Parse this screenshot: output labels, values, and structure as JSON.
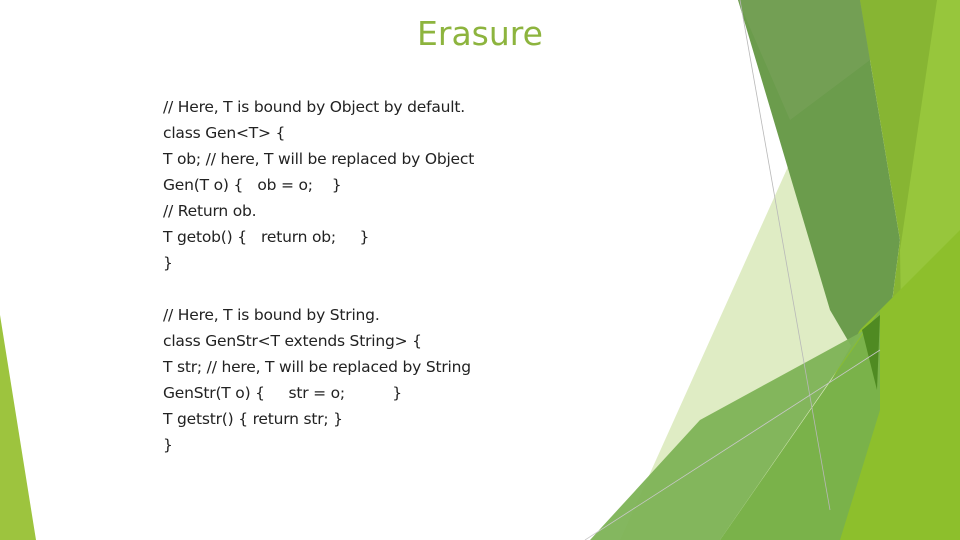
{
  "slide": {
    "title": "Erasure",
    "colors": {
      "title": "#8db43e",
      "text": "#222222",
      "green_dark": "#4f8a22",
      "green_mid": "#6a9a44",
      "green_bright": "#8db82c",
      "green_light": "#a2c84a",
      "green_pale": "#dfecc4"
    },
    "block1": [
      "// Here, T is bound by Object by default.",
      "class Gen<T> {",
      "T ob; // here, T will be replaced by Object",
      "Gen(T o) {   ob = o;    }",
      "// Return ob.",
      "T getob() {   return ob;     }",
      "}"
    ],
    "block2": [
      "// Here, T is bound by String.",
      "class GenStr<T extends String> {",
      "T str; // here, T will be replaced by String",
      "GenStr(T o) {     str = o;          }",
      "T getstr() { return str; }",
      "}"
    ]
  }
}
